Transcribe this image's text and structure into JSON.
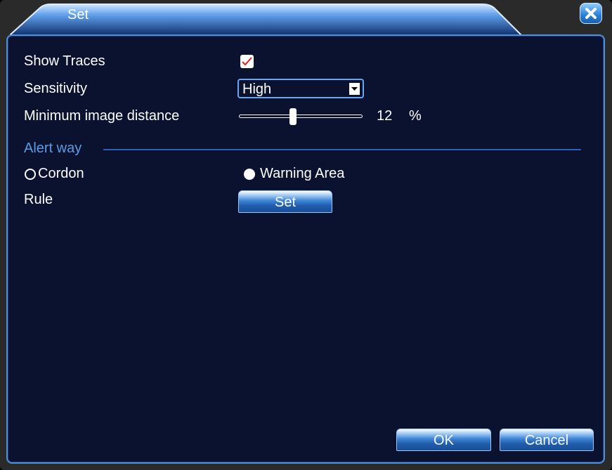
{
  "window": {
    "title": "Set"
  },
  "form": {
    "show_traces_label": "Show Traces",
    "show_traces_checked": true,
    "sensitivity_label": "Sensitivity",
    "sensitivity_value": "High",
    "min_distance_label": "Minimum image distance",
    "min_distance_value": "12",
    "min_distance_unit": "%",
    "min_distance_percent": 12,
    "alert_way_label": "Alert way",
    "alert_options": [
      {
        "label": "Cordon",
        "selected": false
      },
      {
        "label": "Warning Area",
        "selected": true
      }
    ],
    "rule_label": "Rule",
    "rule_button": "Set"
  },
  "footer": {
    "ok_label": "OK",
    "cancel_label": "Cancel"
  },
  "colors": {
    "panel_bg": "#0a1230",
    "accent_border": "#4f8fd8",
    "check_mark": "#e02020"
  }
}
